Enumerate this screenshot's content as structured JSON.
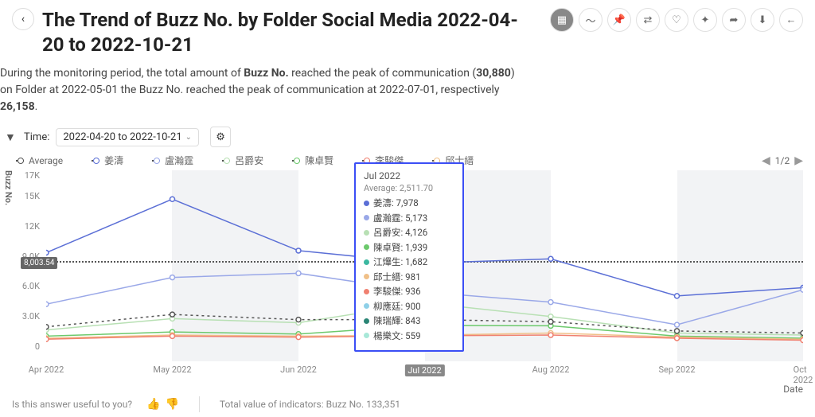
{
  "header": {
    "title": "The Trend of Buzz No. by Folder Social Media 2022-04-20 to 2022-10-21"
  },
  "description": {
    "pre": "During the monitoring period, the total amount of ",
    "metric": "Buzz No.",
    "mid": " reached the peak of communication (",
    "peak": "30,880",
    "post": ") on Folder at 2022-05-01 the Buzz No. reached the peak of communication at 2022-07-01, respectively ",
    "val2": "26,158",
    "end": "."
  },
  "filter": {
    "time_label": "Time:",
    "time_value": "2022-04-20 to 2022-10-21"
  },
  "legend": {
    "items": [
      "Average",
      "姜濤",
      "盧瀚霆",
      "呂爵安",
      "陳卓賢",
      "李駿傑",
      "邱士縉"
    ],
    "pager": "1/2"
  },
  "tooltip": {
    "head": "Jul 2022",
    "avg": "Average: 2,511.70",
    "rows": [
      {
        "c": "#5b6fd6",
        "t": "姜濤: 7,978"
      },
      {
        "c": "#9aa8e8",
        "t": "盧瀚霆: 5,173"
      },
      {
        "c": "#b8e0b4",
        "t": "呂爵安: 4,126"
      },
      {
        "c": "#6cc96c",
        "t": "陳卓賢: 1,939"
      },
      {
        "c": "#3cb8a0",
        "t": "江𤒹生: 1,682"
      },
      {
        "c": "#f0c088",
        "t": "邱士縉: 981"
      },
      {
        "c": "#f08070",
        "t": "李駿傑: 936"
      },
      {
        "c": "#8ed0e8",
        "t": "柳應廷: 900"
      },
      {
        "c": "#2a8575",
        "t": "陳瑞輝: 843"
      },
      {
        "c": "#a8e8d8",
        "t": "楊樂文: 559"
      }
    ]
  },
  "chart_data": {
    "type": "line",
    "xlabel": "Date",
    "ylabel": "Buzz No.",
    "ylim": [
      0,
      17000
    ],
    "average_line": 8003.54,
    "average_label": "8,003.54",
    "x": [
      "Apr 2022",
      "May 2022",
      "Jun 2022",
      "Jul 2022",
      "Aug 2022",
      "Sep 2022",
      "Oct 2022"
    ],
    "x_highlight": "Jul 2022",
    "yticks": [
      "0",
      "3.0K",
      "6.0K",
      "9.0K",
      "12K",
      "15K",
      "17K"
    ],
    "bands": [
      [
        1,
        2
      ],
      [
        3,
        4
      ],
      [
        5,
        6
      ]
    ],
    "series": [
      {
        "name": "姜濤",
        "color": "#5b6fd6",
        "values": [
          9000,
          14200,
          9200,
          7978,
          8400,
          4800,
          5600
        ]
      },
      {
        "name": "盧瀚霆",
        "color": "#9aa8e8",
        "values": [
          4000,
          6600,
          7000,
          5173,
          4200,
          2000,
          5400
        ]
      },
      {
        "name": "呂爵安",
        "color": "#b8e0b4",
        "values": [
          1500,
          2600,
          2200,
          4126,
          2800,
          1200,
          1000
        ]
      },
      {
        "name": "陳卓賢",
        "color": "#6cc96c",
        "values": [
          900,
          1300,
          1100,
          1939,
          1900,
          900,
          700
        ]
      },
      {
        "name": "邱士縉",
        "color": "#f0c088",
        "values": [
          700,
          1000,
          900,
          981,
          1200,
          800,
          600
        ]
      },
      {
        "name": "李駿傑",
        "color": "#f08070",
        "values": [
          600,
          900,
          800,
          936,
          1000,
          700,
          500
        ]
      },
      {
        "name": "Average",
        "color": "#555555",
        "dashed": true,
        "values": [
          1800,
          3000,
          2500,
          2512,
          2300,
          1400,
          1200
        ]
      }
    ]
  },
  "footer": {
    "useful": "Is this answer useful to you?",
    "total_label": "Total value of indicators:",
    "total_value": "Buzz No. 133,351"
  }
}
